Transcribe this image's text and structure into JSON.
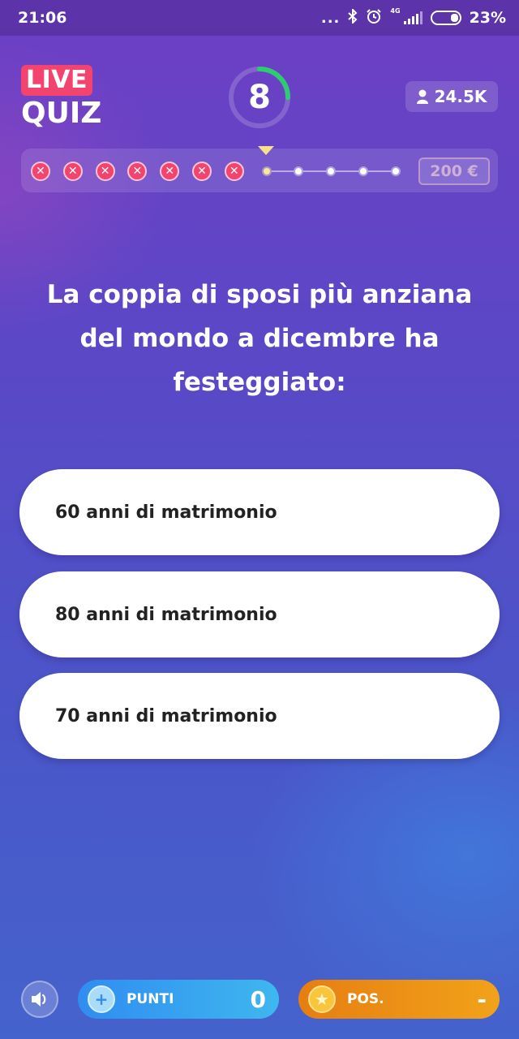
{
  "status_bar": {
    "time": "21:06",
    "dots": "...",
    "network": "4G",
    "battery": "23%"
  },
  "logo": {
    "live": "LIVE",
    "quiz": "QUIZ"
  },
  "timer": {
    "value": "8",
    "remaining_fraction": 0.25,
    "ring_color": "#2ecc71"
  },
  "viewers": {
    "count": "24.5K"
  },
  "progress": {
    "missed_count": 7,
    "current_index": 7,
    "total_steps": 12,
    "prize": "200 €"
  },
  "question": {
    "text": "La coppia di sposi più anziana del mondo a dicembre ha festeggiato:"
  },
  "answers": [
    {
      "label": "60 anni di matrimonio"
    },
    {
      "label": "80 anni di matrimonio"
    },
    {
      "label": "70 anni di matrimonio"
    }
  ],
  "bottom_bar": {
    "points_label": "PUNTI",
    "points_value": "0",
    "position_label": "POS.",
    "position_value": "-"
  },
  "colors": {
    "accent_pink": "#f2446e",
    "points_blue": "#2f8df0",
    "position_orange": "#e67e12"
  }
}
